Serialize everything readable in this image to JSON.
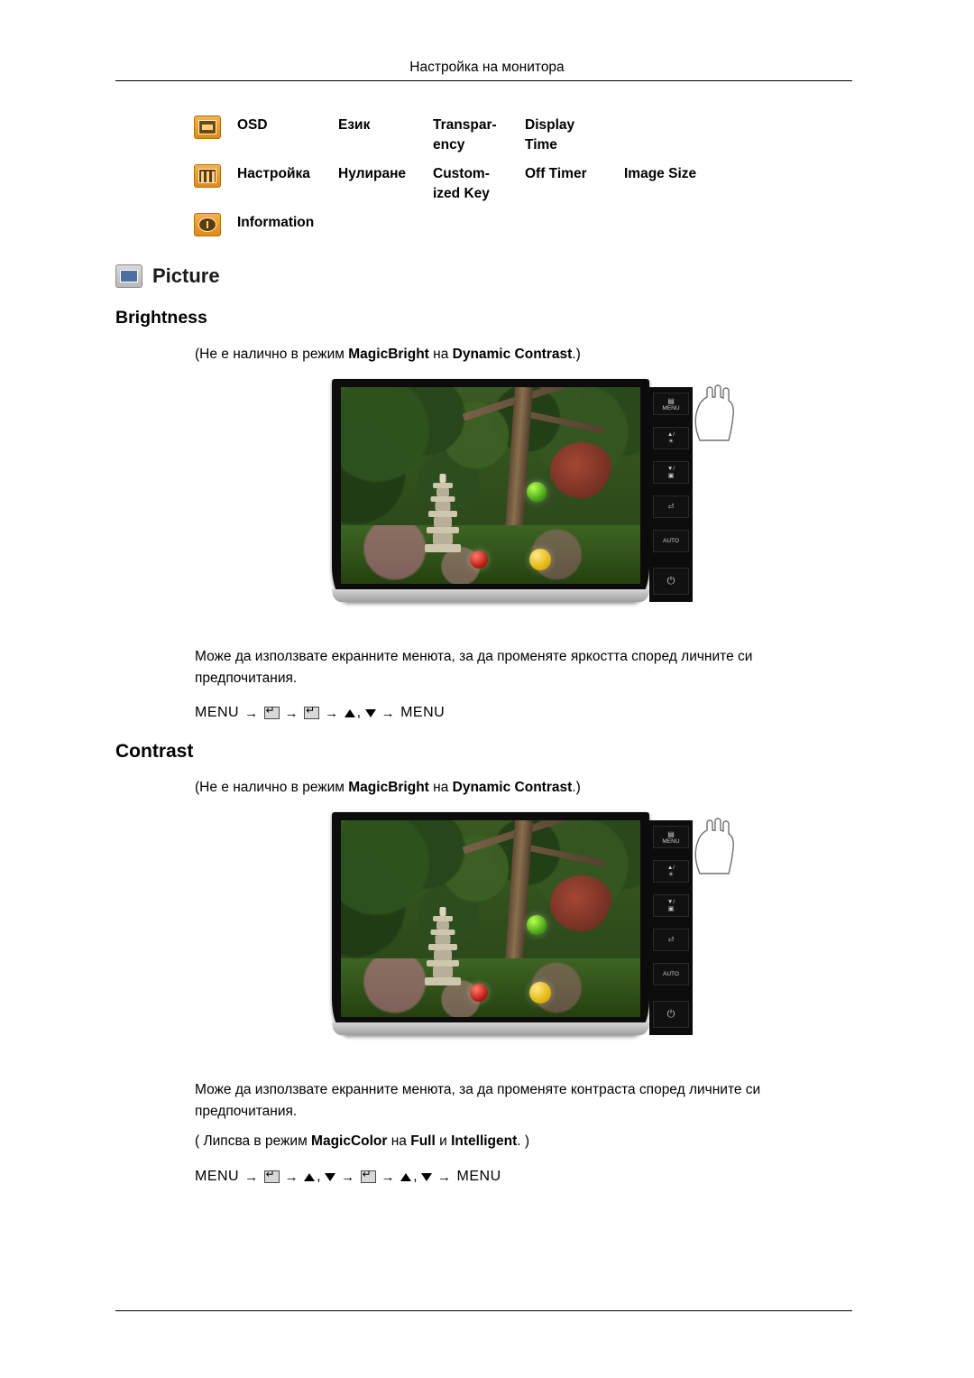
{
  "header": {
    "title": "Настройка на монитора"
  },
  "menu_grid": {
    "rows": [
      {
        "icon": "osd-icon",
        "cells": [
          "OSD",
          "Език",
          "Transpar-\nency",
          "Display\nTime",
          ""
        ]
      },
      {
        "icon": "setup-icon",
        "cells": [
          "Настройка",
          "Нулиране",
          "Custom-\nized Key",
          "Off Timer",
          "Image Size"
        ]
      },
      {
        "icon": "information-icon",
        "cells": [
          "Information",
          "",
          "",
          "",
          ""
        ]
      }
    ],
    "r0c1": "OSD",
    "r0c2": "Език",
    "r0c3a": "Transpar-",
    "r0c3b": "ency",
    "r0c4a": "Display",
    "r0c4b": "Time",
    "r1c1": "Настройка",
    "r1c2": "Нулиране",
    "r1c3a": "Custom-",
    "r1c3b": "ized Key",
    "r1c4": "Off Timer",
    "r1c5": "Image Size",
    "r2c1": "Information"
  },
  "picture_section": {
    "label": "Picture"
  },
  "brightness": {
    "heading": "Brightness",
    "note_prefix": "(Не е налично в режим ",
    "note_bold1": "MagicBright",
    "note_mid": " на ",
    "note_bold2": "Dynamic Contrast",
    "note_suffix": ".)",
    "paragraph": "Може да използвате екранните менюта, за да променяте яркостта според личните си предпочитания.",
    "menupath": {
      "start": "MENU",
      "end": "MENU",
      "arrow": "→",
      "comma": ","
    }
  },
  "contrast": {
    "heading": "Contrast",
    "note_prefix": "(Не е налично в режим ",
    "note_bold1": "MagicBright",
    "note_mid": " на ",
    "note_bold2": "Dynamic Contrast",
    "note_suffix": ".)",
    "paragraph": "Може да използвате екранните менюта, за да променяте контраста според личните си предпочитания.",
    "magiccolor_prefix": "( Липсва в режим ",
    "magiccolor_bold1": "MagicColor",
    "magiccolor_mid": " на ",
    "magiccolor_bold2": "Full",
    "magiccolor_mid2": " и ",
    "magiccolor_bold3": "Intelligent",
    "magiccolor_suffix": ". )",
    "menupath": {
      "start": "MENU",
      "end": "MENU",
      "arrow": "→",
      "comma": ","
    }
  },
  "monitor_illustration": {
    "buttons": [
      "MENU",
      "▲/☀",
      "▼/▣",
      "⏎",
      "AUTO",
      "⏻"
    ],
    "button_labels": {
      "menu": "MENU",
      "up": "▲/",
      "down": "▼/",
      "enter": "",
      "auto": "AUTO",
      "power": ""
    }
  },
  "colors": {
    "accent_icon": "#e8a33a",
    "picture_icon": "#c8c8c8",
    "text": "#000000",
    "rule": "#000000"
  }
}
